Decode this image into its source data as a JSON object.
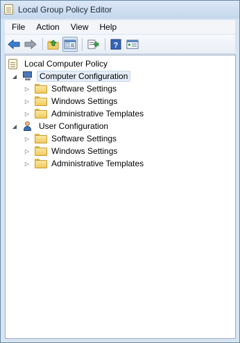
{
  "window": {
    "title": "Local Group Policy Editor"
  },
  "menu": {
    "items": [
      "File",
      "Action",
      "View",
      "Help"
    ]
  },
  "toolbar": {
    "buttons": [
      "back-icon",
      "forward-icon",
      "up-folder-icon",
      "show-hide-tree-icon",
      "export-list-icon",
      "help-icon",
      "properties-icon"
    ]
  },
  "tree": {
    "root": {
      "label": "Local Computer Policy"
    },
    "computer": {
      "label": "Computer Configuration",
      "children": [
        "Software Settings",
        "Windows Settings",
        "Administrative Templates"
      ]
    },
    "user": {
      "label": "User Configuration",
      "children": [
        "Software Settings",
        "Windows Settings",
        "Administrative Templates"
      ]
    }
  },
  "colors": {
    "accent": "#3d6fb5",
    "selection": "#e5eef9",
    "folder": "#f0c95e"
  }
}
